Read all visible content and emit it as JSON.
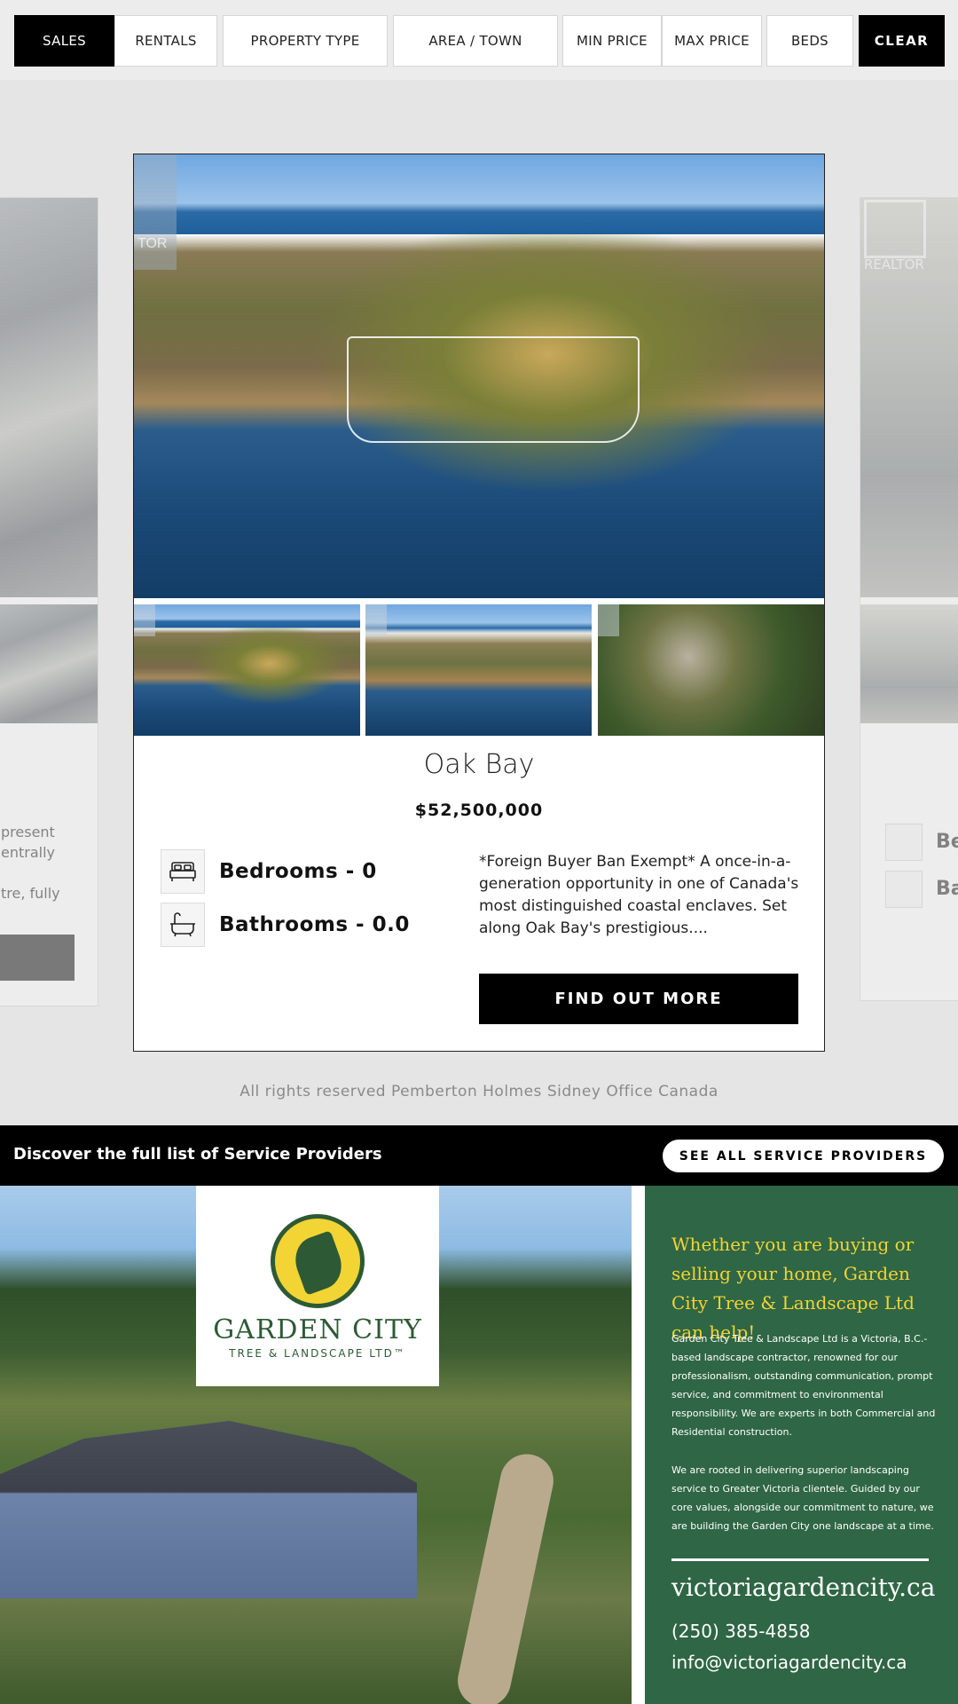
{
  "filters": {
    "sales": "SALES",
    "rentals": "RENTALS",
    "property_type": "PROPERTY TYPE",
    "area_town": "AREA / TOWN",
    "min_price": "MIN PRICE",
    "max_price": "MAX PRICE",
    "beds": "BEDS",
    "clear": "CLEAR"
  },
  "left_card": {
    "desc_lines": [
      "present",
      "entrally",
      "",
      "tre, fully"
    ]
  },
  "right_card": {
    "realtor": "REALTOR",
    "bed_partial": "Be",
    "bath_partial": "Ba"
  },
  "listing": {
    "realtor_mark": "TOR",
    "city": "Oak Bay",
    "price": "$52,500,000",
    "bedrooms": "Bedrooms - 0",
    "bathrooms": "Bathrooms - 0.0",
    "description": "*Foreign Buyer Ban Exempt* A once-in-a-generation opportunity in one of Canada's most distinguished coastal enclaves. Set along Oak Bay's prestigious....",
    "cta": "FIND OUT MORE"
  },
  "footer": {
    "rights": "All rights reserved Pemberton Holmes Sidney Office Canada"
  },
  "service_providers": {
    "text": "Discover the full list of Service Providers",
    "button": "SEE ALL SERVICE PROVIDERS"
  },
  "ad": {
    "logo_name": "GARDEN CITY",
    "logo_sub": "TREE & LANDSCAPE LTD™",
    "headline": "Whether you are buying or selling your home, Garden City Tree & Landscape Ltd can help!",
    "body1": "Garden City Tree & Landscape Ltd is a Victoria, B.C.-based landscape contractor, renowned for our professionalism, outstanding communication, prompt service, and commitment to environmental responsibility. We are experts in both Commercial and Residential construction.",
    "body2": "We are rooted in delivering superior landscaping service to Greater Victoria clientele. Guided by our core values, alongside our commitment to nature, we are building the Garden City one landscape at a time.",
    "website": "victoriagardencity.ca",
    "phone": "(250) 385-4858",
    "email": "info@victoriagardencity.ca"
  },
  "colors": {
    "accent_black": "#000000",
    "ad_green": "#2f6645",
    "ad_yellow": "#f2d434"
  }
}
